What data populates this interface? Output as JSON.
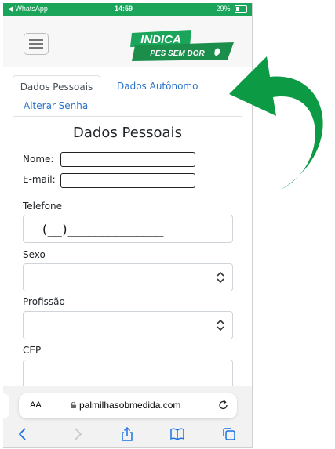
{
  "status_bar": {
    "back_app": "◀ WhatsApp",
    "time": "14:59",
    "battery": "29%",
    "battery_level": 0.29
  },
  "header": {
    "logo_line1": "INDICA",
    "logo_line2": "PÉS SEM DOR"
  },
  "tabs": [
    {
      "label": "Dados Pessoais",
      "active": true
    },
    {
      "label": "Dados Autônomo",
      "active": false
    },
    {
      "label": "Alterar Senha",
      "active": false
    }
  ],
  "form": {
    "title": "Dados Pessoais",
    "nome_label": "Nome:",
    "email_label": "E-mail:",
    "telefone_label": "Telefone",
    "telefone_value": "(__)______________",
    "sexo_label": "Sexo",
    "profissao_label": "Profissão",
    "cep_label": "CEP"
  },
  "browser": {
    "aa": "AA",
    "url": "palmilhasobmedida.com"
  },
  "colors": {
    "brand_green": "#1aa55a",
    "arrow_green": "#0c9a45",
    "link_blue": "#2a73c8"
  },
  "icons": [
    "back-icon",
    "forward-icon",
    "share-icon",
    "bookmarks-icon",
    "tabs-icon",
    "reload-icon",
    "lock-icon",
    "chevron-updown-icon",
    "hamburger-icon"
  ]
}
